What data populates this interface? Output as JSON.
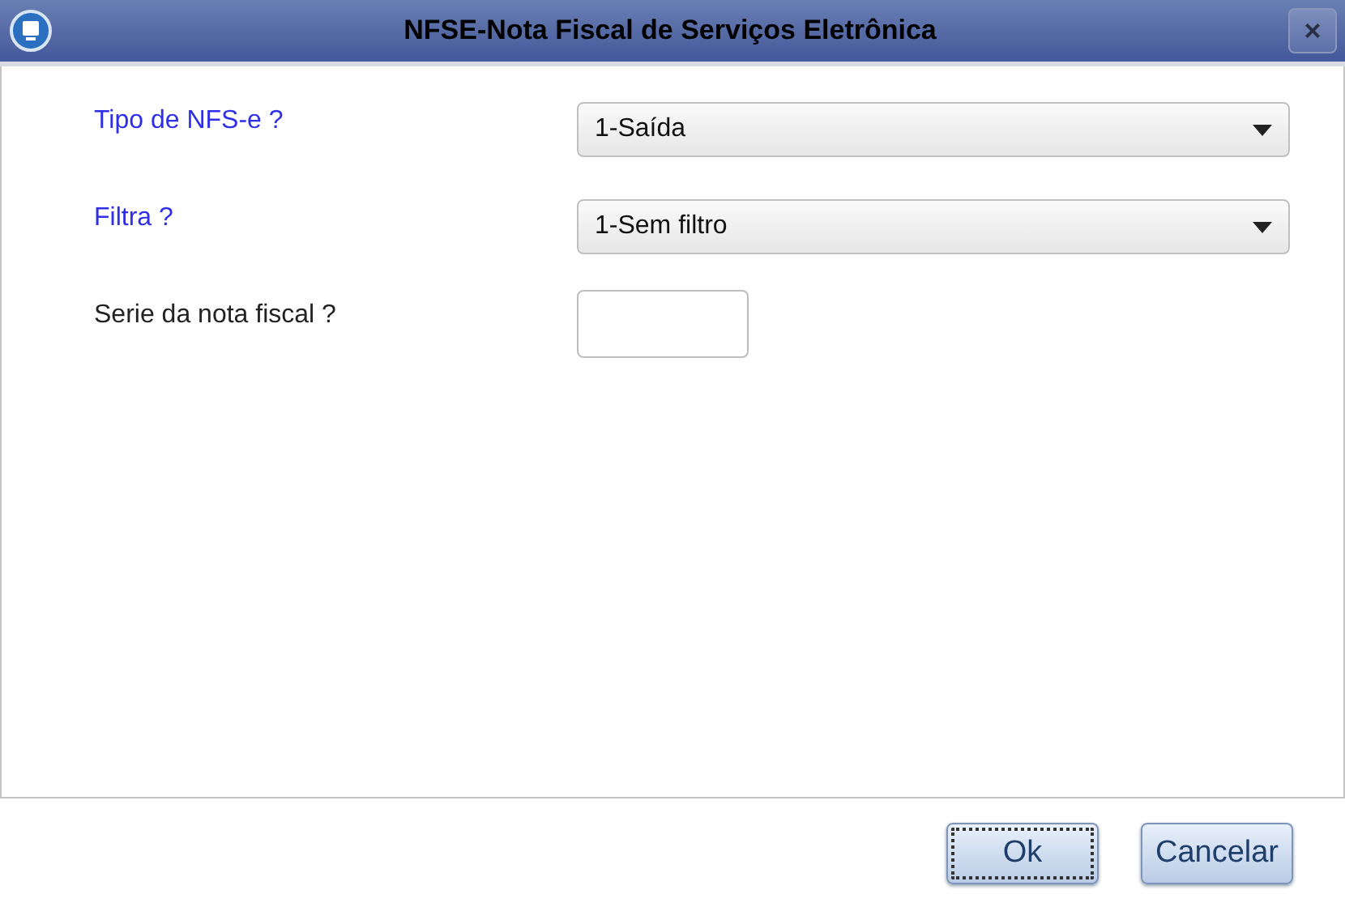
{
  "window": {
    "title": "NFSE-Nota Fiscal de Serviços Eletrônica",
    "close": "×"
  },
  "fields": [
    {
      "label": "Tipo de NFS-e ?",
      "required": true,
      "kind": "select",
      "value": "1-Saída"
    },
    {
      "label": "Filtra ?",
      "required": true,
      "kind": "select",
      "value": "1-Sem filtro"
    },
    {
      "label": "Serie da nota fiscal ?",
      "required": false,
      "kind": "text"
    }
  ],
  "buttons": [
    {
      "label": "Ok",
      "focused": true
    },
    {
      "label": "Cancelar",
      "focused": false
    }
  ]
}
